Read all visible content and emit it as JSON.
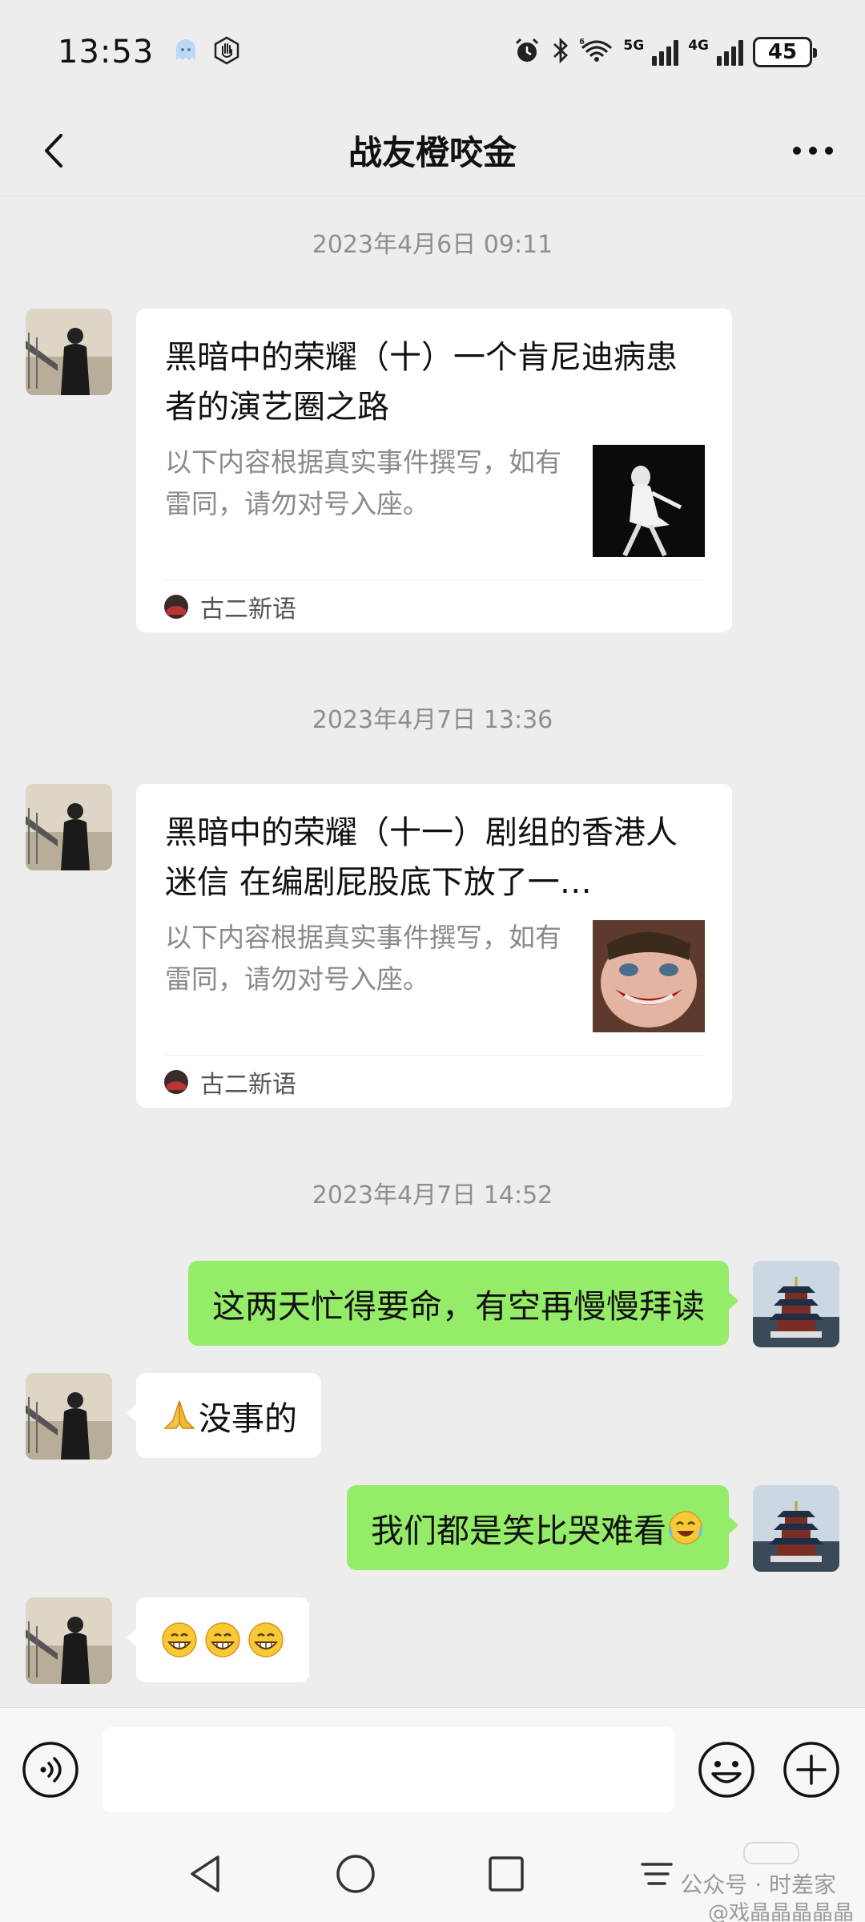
{
  "status_bar": {
    "time": "13:53",
    "net_1": "5G",
    "net_2": "4G",
    "battery": "45",
    "icons": [
      "ghost-app-icon",
      "hand-icon",
      "alarm-icon",
      "bluetooth-icon",
      "wifi-icon",
      "signal-icon"
    ]
  },
  "header": {
    "title": "战友橙咬金",
    "back_icon": "chevron-left-icon",
    "more_icon": "more-dots-icon"
  },
  "messages": [
    {
      "type": "timestamp",
      "text": "2023年4月6日 09:11"
    },
    {
      "type": "article",
      "side": "left",
      "title": "黑暗中的荣耀（十）一个肯尼迪病患者的演艺圈之路",
      "desc": "以下内容根据真实事件撰写，如有雷同，请勿对号入座。",
      "source": "古二新语",
      "thumb": "ballet-photo"
    },
    {
      "type": "timestamp",
      "text": "2023年4月7日 13:36"
    },
    {
      "type": "article",
      "side": "left",
      "title": "黑暗中的荣耀（十一）剧组的香港人迷信 在编剧屁股底下放了一…",
      "desc": "以下内容根据真实事件撰写，如有雷同，请勿对号入座。",
      "source": "古二新语",
      "thumb": "joker-photo"
    },
    {
      "type": "timestamp",
      "text": "2023年4月7日 14:52"
    },
    {
      "type": "text",
      "side": "right",
      "text": "这两天忙得要命，有空再慢慢拜读"
    },
    {
      "type": "text",
      "side": "left",
      "text": "没事的",
      "emoji_before": "pray-emoji"
    },
    {
      "type": "text",
      "side": "right",
      "text": "我们都是笑比哭难看",
      "emoji_after": "laugh-cry-emoji"
    },
    {
      "type": "emoji",
      "side": "left",
      "emojis": [
        "grin-emoji",
        "grin-emoji",
        "grin-emoji"
      ]
    }
  ],
  "input_bar": {
    "placeholder": "",
    "voice_icon": "voice-icon",
    "emoji_icon": "emoji-face-icon",
    "plus_icon": "plus-icon"
  },
  "nav_bar": {
    "icons": [
      "nav-back-icon",
      "nav-home-icon",
      "nav-recents-icon",
      "nav-menu-icon"
    ]
  },
  "watermark": {
    "line1": "公众号 · 时差家",
    "line2": "@戏晶晶晶晶晶"
  },
  "colors": {
    "background": "#ededed",
    "bubble_right": "#95ec69",
    "bubble_left": "#ffffff",
    "timestamp_text": "#8e8e8e"
  }
}
